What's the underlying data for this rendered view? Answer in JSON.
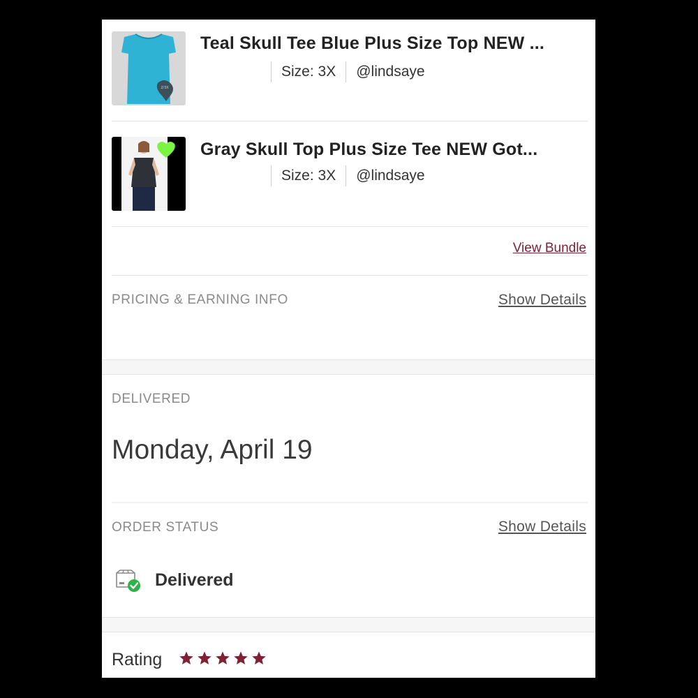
{
  "items": [
    {
      "title": "Teal Skull Tee Blue Plus Size Top NEW ...",
      "size": "Size: 3X",
      "seller": "@lindsaye",
      "thumb_icon": "teal-tee-photo"
    },
    {
      "title": "Gray Skull Top Plus Size Tee NEW Got...",
      "size": "Size: 3X",
      "seller": "@lindsaye",
      "thumb_icon": "gray-top-model-photo"
    }
  ],
  "bundle": {
    "link_label": "View Bundle"
  },
  "pricing": {
    "label": "PRICING & EARNING INFO",
    "details_label": "Show Details"
  },
  "delivered": {
    "label": "DELIVERED",
    "date": "Monday, April 19"
  },
  "order_status": {
    "label": "ORDER STATUS",
    "details_label": "Show Details",
    "status": "Delivered",
    "status_icon": "package-delivered-icon"
  },
  "rating": {
    "label": "Rating",
    "stars": 5,
    "max_stars": 5
  },
  "colors": {
    "brand": "#7f2134",
    "star": "#7f2134",
    "success": "#2eb24a",
    "teal_product": "#2fb3d4",
    "neon_heart": "#7cf542"
  }
}
